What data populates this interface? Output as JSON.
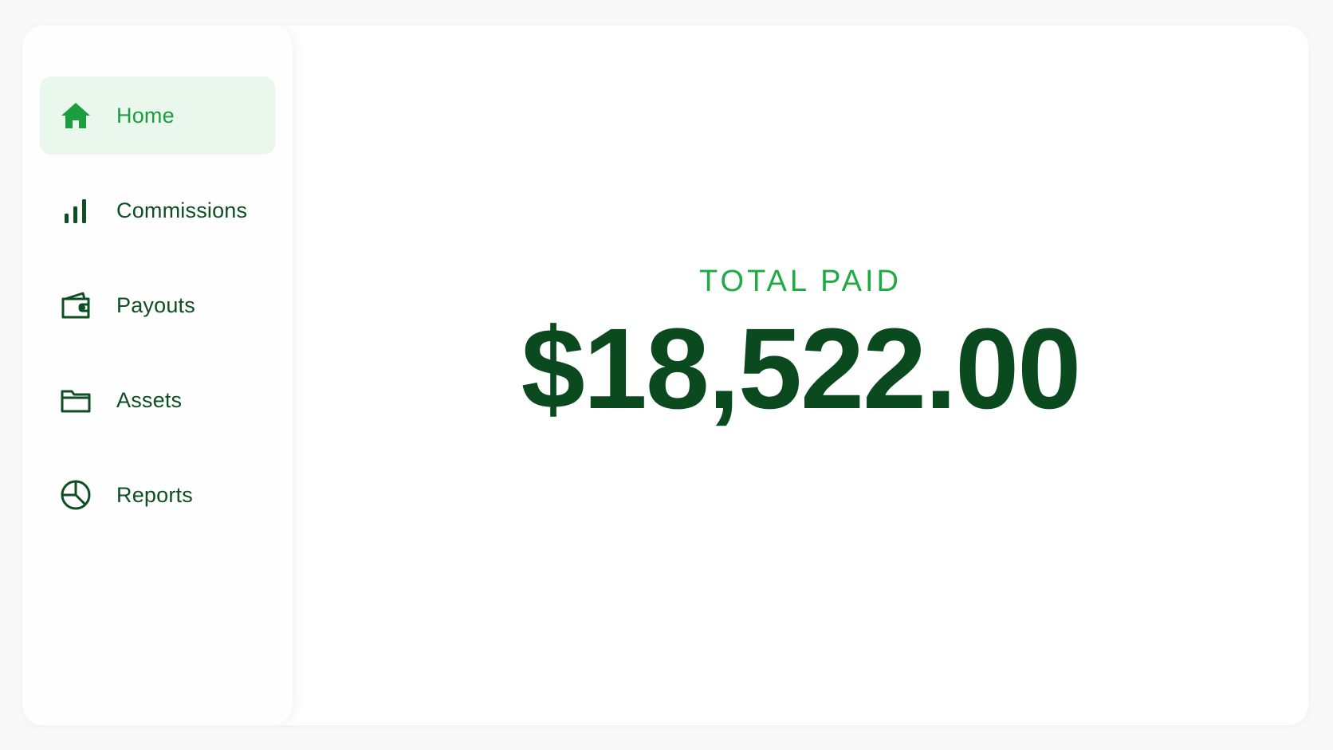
{
  "sidebar": {
    "items": [
      {
        "label": "Home",
        "icon": "home-icon",
        "active": true
      },
      {
        "label": "Commissions",
        "icon": "bar-chart-icon",
        "active": false
      },
      {
        "label": "Payouts",
        "icon": "wallet-icon",
        "active": false
      },
      {
        "label": "Assets",
        "icon": "folder-icon",
        "active": false
      },
      {
        "label": "Reports",
        "icon": "pie-chart-icon",
        "active": false
      }
    ]
  },
  "main": {
    "total_label": "TOTAL PAID",
    "total_amount": "$18,522.00"
  },
  "colors": {
    "accent": "#1faa44",
    "dark_green": "#0b4a1e",
    "active_bg": "#e9f7ec"
  }
}
